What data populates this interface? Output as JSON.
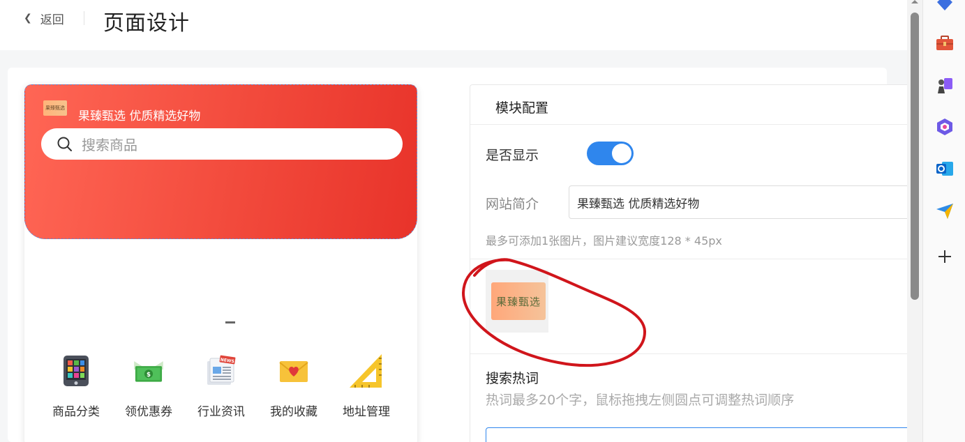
{
  "header": {
    "back_label": "返回",
    "title": "页面设计"
  },
  "preview": {
    "logo_text": "果臻甄选",
    "brand_text": "果臻甄选 优质精选好物",
    "search_placeholder": "搜索商品",
    "nav": [
      {
        "label": "商品分类",
        "icon": "tablet-icon"
      },
      {
        "label": "领优惠券",
        "icon": "coupon-icon"
      },
      {
        "label": "行业资讯",
        "icon": "news-icon"
      },
      {
        "label": "我的收藏",
        "icon": "heart-envelope-icon"
      },
      {
        "label": "地址管理",
        "icon": "ruler-triangle-icon"
      }
    ]
  },
  "config": {
    "title": "模块配置",
    "show_label": "是否显示",
    "show_enabled": true,
    "site_label": "网站简介",
    "site_value": "果臻甄选 优质精选好物",
    "image_hint": "最多可添加1张图片，图片建议宽度128 * 45px",
    "image_logo_text": "果臻甄选",
    "hot_title": "搜索热词",
    "hot_hint": "热词最多20个字，鼠标拖拽左侧圆点可调整热词顺序"
  },
  "sidebar": {
    "icons": [
      "diamond-icon",
      "toolbox-icon",
      "chess-icon",
      "copilot-icon",
      "outlook-icon",
      "send-icon",
      "plus-icon"
    ]
  },
  "colors": {
    "accent": "#2f86ed",
    "banner_start": "#ff6655",
    "banner_end": "#e8332a",
    "annotation": "#d0151b"
  }
}
